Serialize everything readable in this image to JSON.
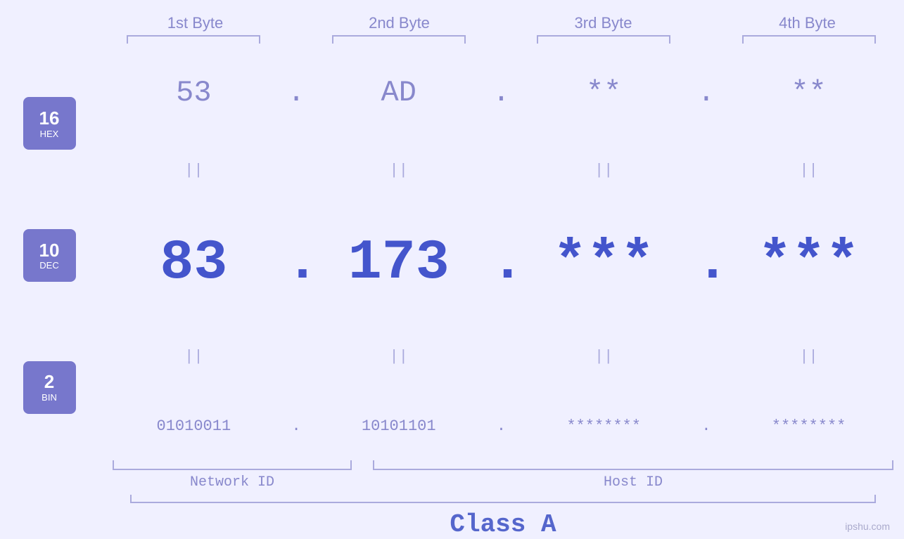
{
  "headers": {
    "byte1": "1st Byte",
    "byte2": "2nd Byte",
    "byte3": "3rd Byte",
    "byte4": "4th Byte"
  },
  "badges": {
    "hex": {
      "num": "16",
      "label": "HEX"
    },
    "dec": {
      "num": "10",
      "label": "DEC"
    },
    "bin": {
      "num": "2",
      "label": "BIN"
    }
  },
  "rows": {
    "hex": {
      "b1": "53",
      "b2": "AD",
      "b3": "**",
      "b4": "**"
    },
    "dec": {
      "b1": "83",
      "b2": "173",
      "b3": "***",
      "b4": "***"
    },
    "bin": {
      "b1": "01010011",
      "b2": "10101101",
      "b3": "********",
      "b4": "********"
    }
  },
  "labels": {
    "network_id": "Network ID",
    "host_id": "Host ID",
    "class": "Class A"
  },
  "watermark": "ipshu.com"
}
